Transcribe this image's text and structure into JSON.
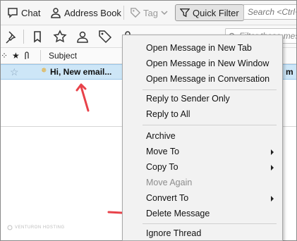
{
  "toolbar": {
    "chat_label": "Chat",
    "address_book_label": "Address Book",
    "tag_label": "Tag",
    "quick_filter_label": "Quick Filter",
    "search_placeholder": "Search <Ctrl+"
  },
  "filter_bar": {
    "search_placeholder": "Filter these mes"
  },
  "columns": {
    "subject": "Subject"
  },
  "message": {
    "subject": "Hi, New email...",
    "trailing": "m"
  },
  "context_menu": {
    "open_new_tab": "Open Message in New Tab",
    "open_new_window": "Open Message in New Window",
    "open_conversation": "Open Message in Conversation",
    "reply_sender": "Reply to Sender Only",
    "reply_all": "Reply to All",
    "archive": "Archive",
    "move_to": "Move To",
    "copy_to": "Copy To",
    "move_again": "Move Again",
    "convert_to": "Convert To",
    "delete": "Delete Message",
    "ignore_thread": "Ignore Thread"
  },
  "watermark": "VENTURON HOSTING",
  "colors": {
    "annotation_arrow": "#e8424a",
    "selected_row": "#cde6f7"
  }
}
